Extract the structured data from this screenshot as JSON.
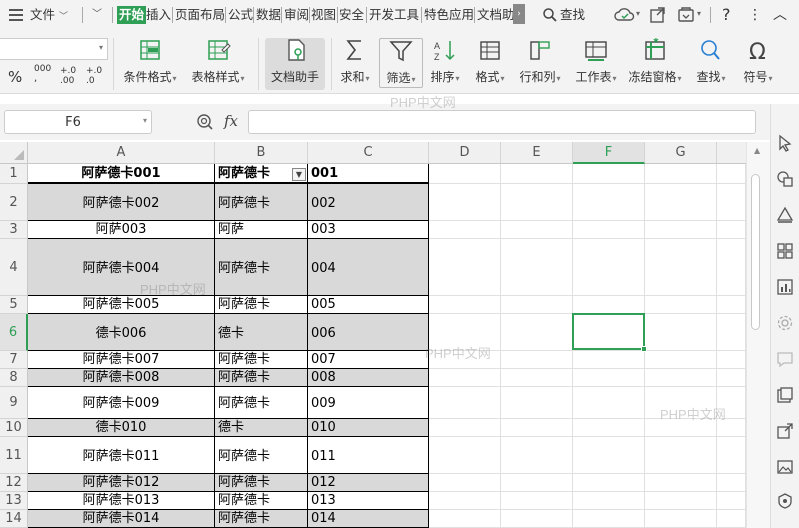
{
  "titlebar": {
    "file_menu": "文件",
    "tabs": [
      {
        "label": "开始",
        "active": true
      },
      {
        "label": "插入"
      },
      {
        "label": "页面布局"
      },
      {
        "label": "公式"
      },
      {
        "label": "数据"
      },
      {
        "label": "审阅"
      },
      {
        "label": "视图"
      },
      {
        "label": "安全"
      },
      {
        "label": "开发工具"
      },
      {
        "label": "特色应用"
      },
      {
        "label": "文档助"
      }
    ],
    "search_label": "查找",
    "accent_color": "#2e9f54"
  },
  "ribbon": {
    "buttons": [
      {
        "label": "条件格式",
        "icon": "conditional-format-icon"
      },
      {
        "label": "表格样式",
        "icon": "table-style-icon"
      },
      {
        "label": "文档助手",
        "icon": "doc-assistant-icon"
      },
      {
        "label": "求和",
        "icon": "sum-icon"
      },
      {
        "label": "筛选",
        "icon": "filter-icon"
      },
      {
        "label": "排序",
        "icon": "sort-icon"
      },
      {
        "label": "格式",
        "icon": "format-icon"
      },
      {
        "label": "行和列",
        "icon": "row-col-icon"
      },
      {
        "label": "工作表",
        "icon": "worksheet-icon"
      },
      {
        "label": "冻结窗格",
        "icon": "freeze-pane-icon"
      },
      {
        "label": "查找",
        "icon": "find-icon"
      },
      {
        "label": "符号",
        "icon": "symbol-icon"
      }
    ],
    "num_format": {
      "percent": "%",
      "thousands": "000",
      "inc_decimal": "+.0 .00",
      "dec_decimal": "+.0 .0"
    }
  },
  "formula_bar": {
    "name_box": "F6",
    "fx_label": "fx",
    "formula_value": ""
  },
  "sheet": {
    "columns": [
      "A",
      "B",
      "C",
      "D",
      "E",
      "F",
      "G"
    ],
    "selected_column": "F",
    "selected_row": "6",
    "rows": [
      {
        "num": "1",
        "a": "阿萨德卡001",
        "b": "阿萨德卡",
        "c": "001",
        "gray": false,
        "bold": true
      },
      {
        "num": "2",
        "a": "阿萨德卡002",
        "b": "阿萨德卡",
        "c": "002",
        "gray": true
      },
      {
        "num": "3",
        "a": "阿萨003",
        "b": "阿萨",
        "c": "003",
        "gray": false
      },
      {
        "num": "4",
        "a": "阿萨德卡004",
        "b": "阿萨德卡",
        "c": "004",
        "gray": true
      },
      {
        "num": "5",
        "a": "阿萨德卡005",
        "b": "阿萨德卡",
        "c": "005",
        "gray": false
      },
      {
        "num": "6",
        "a": "德卡006",
        "b": "德卡",
        "c": "006",
        "gray": true
      },
      {
        "num": "7",
        "a": "阿萨德卡007",
        "b": "阿萨德卡",
        "c": "007",
        "gray": false
      },
      {
        "num": "8",
        "a": "阿萨德卡008",
        "b": "阿萨德卡",
        "c": "008",
        "gray": true
      },
      {
        "num": "9",
        "a": "阿萨德卡009",
        "b": "阿萨德卡",
        "c": "009",
        "gray": false
      },
      {
        "num": "10",
        "a": "德卡010",
        "b": "德卡",
        "c": "010",
        "gray": true
      },
      {
        "num": "11",
        "a": "阿萨德卡011",
        "b": "阿萨德卡",
        "c": "011",
        "gray": false
      },
      {
        "num": "12",
        "a": "阿萨德卡012",
        "b": "阿萨德卡",
        "c": "012",
        "gray": true
      },
      {
        "num": "13",
        "a": "阿萨德卡013",
        "b": "阿萨德卡",
        "c": "013",
        "gray": false
      },
      {
        "num": "14",
        "a": "阿萨德卡014",
        "b": "阿萨德卡",
        "c": "014",
        "gray": true
      }
    ]
  },
  "watermark": "PHP中文网"
}
